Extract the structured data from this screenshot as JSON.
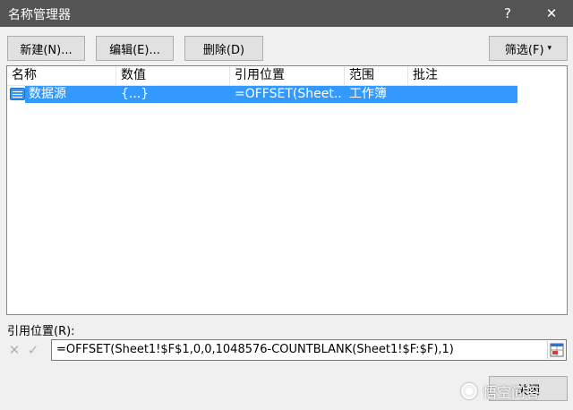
{
  "window": {
    "title": "名称管理器",
    "help_glyph": "?",
    "close_glyph": "✕"
  },
  "toolbar": {
    "new_label": "新建(N)...",
    "edit_label": "编辑(E)...",
    "delete_label": "删除(D)",
    "filter_label": "筛选(F)",
    "filter_chevron": "▾"
  },
  "list": {
    "columns": [
      "名称",
      "数值",
      "引用位置",
      "范围",
      "批注"
    ],
    "rows": [
      {
        "name": "数据源",
        "value": "{...}",
        "refers_to": "=OFFSET(Sheet...",
        "scope": "工作簿",
        "comment": "",
        "selected": true,
        "icon": "named-range-icon"
      }
    ]
  },
  "refers_to": {
    "label": "引用位置(R):",
    "value": "=OFFSET(Sheet1!$F$1,0,0,1048576-COUNTBLANK(Sheet1!$F:$F),1)",
    "cancel_glyph": "✕",
    "confirm_glyph": "✓"
  },
  "footer": {
    "close_label": "关闭"
  },
  "watermark": {
    "text": "悟空问答",
    "icon": "wukong-logo-icon"
  },
  "colors": {
    "title_bar": "#545454",
    "selection": "#3399ff",
    "dialog_bg": "#f0f0f0"
  }
}
